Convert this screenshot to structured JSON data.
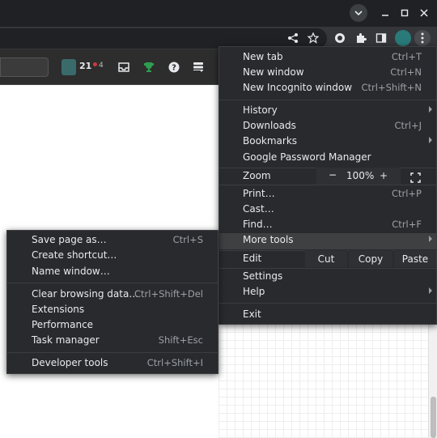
{
  "site": {
    "reputation": "21",
    "badge_count": "4"
  },
  "menu": {
    "new_tab": {
      "label": "New tab",
      "shortcut": "Ctrl+T"
    },
    "new_window": {
      "label": "New window",
      "shortcut": "Ctrl+N"
    },
    "new_incognito": {
      "label": "New Incognito window",
      "shortcut": "Ctrl+Shift+N"
    },
    "history": {
      "label": "History"
    },
    "downloads": {
      "label": "Downloads",
      "shortcut": "Ctrl+J"
    },
    "bookmarks": {
      "label": "Bookmarks"
    },
    "password_manager": {
      "label": "Google Password Manager"
    },
    "zoom": {
      "label": "Zoom",
      "minus": "−",
      "value": "100%",
      "plus": "+"
    },
    "print": {
      "label": "Print…",
      "shortcut": "Ctrl+P"
    },
    "cast": {
      "label": "Cast…"
    },
    "find": {
      "label": "Find…",
      "shortcut": "Ctrl+F"
    },
    "more_tools": {
      "label": "More tools"
    },
    "edit": {
      "label": "Edit",
      "cut": "Cut",
      "copy": "Copy",
      "paste": "Paste"
    },
    "settings": {
      "label": "Settings"
    },
    "help": {
      "label": "Help"
    },
    "exit": {
      "label": "Exit"
    }
  },
  "submenu": {
    "save_page": {
      "label": "Save page as…",
      "shortcut": "Ctrl+S"
    },
    "create_shortcut": {
      "label": "Create shortcut…"
    },
    "name_window": {
      "label": "Name window…"
    },
    "clear_data": {
      "label": "Clear browsing data…",
      "shortcut": "Ctrl+Shift+Del"
    },
    "extensions": {
      "label": "Extensions"
    },
    "performance": {
      "label": "Performance"
    },
    "task_manager": {
      "label": "Task manager",
      "shortcut": "Shift+Esc"
    },
    "dev_tools": {
      "label": "Developer tools",
      "shortcut": "Ctrl+Shift+I"
    }
  },
  "icons": {
    "window_dropdown": "chevron-down-icon",
    "share": "share-icon",
    "bookmark": "star-icon",
    "extensions": "puzzle-icon",
    "side_panel": "side-panel-icon",
    "menu": "three-dots-icon"
  },
  "colors": {
    "menu_bg": "#292a2d",
    "highlight": "#3f4042",
    "text": "#e8eaed",
    "shortcut_text": "#9aa0a6"
  }
}
